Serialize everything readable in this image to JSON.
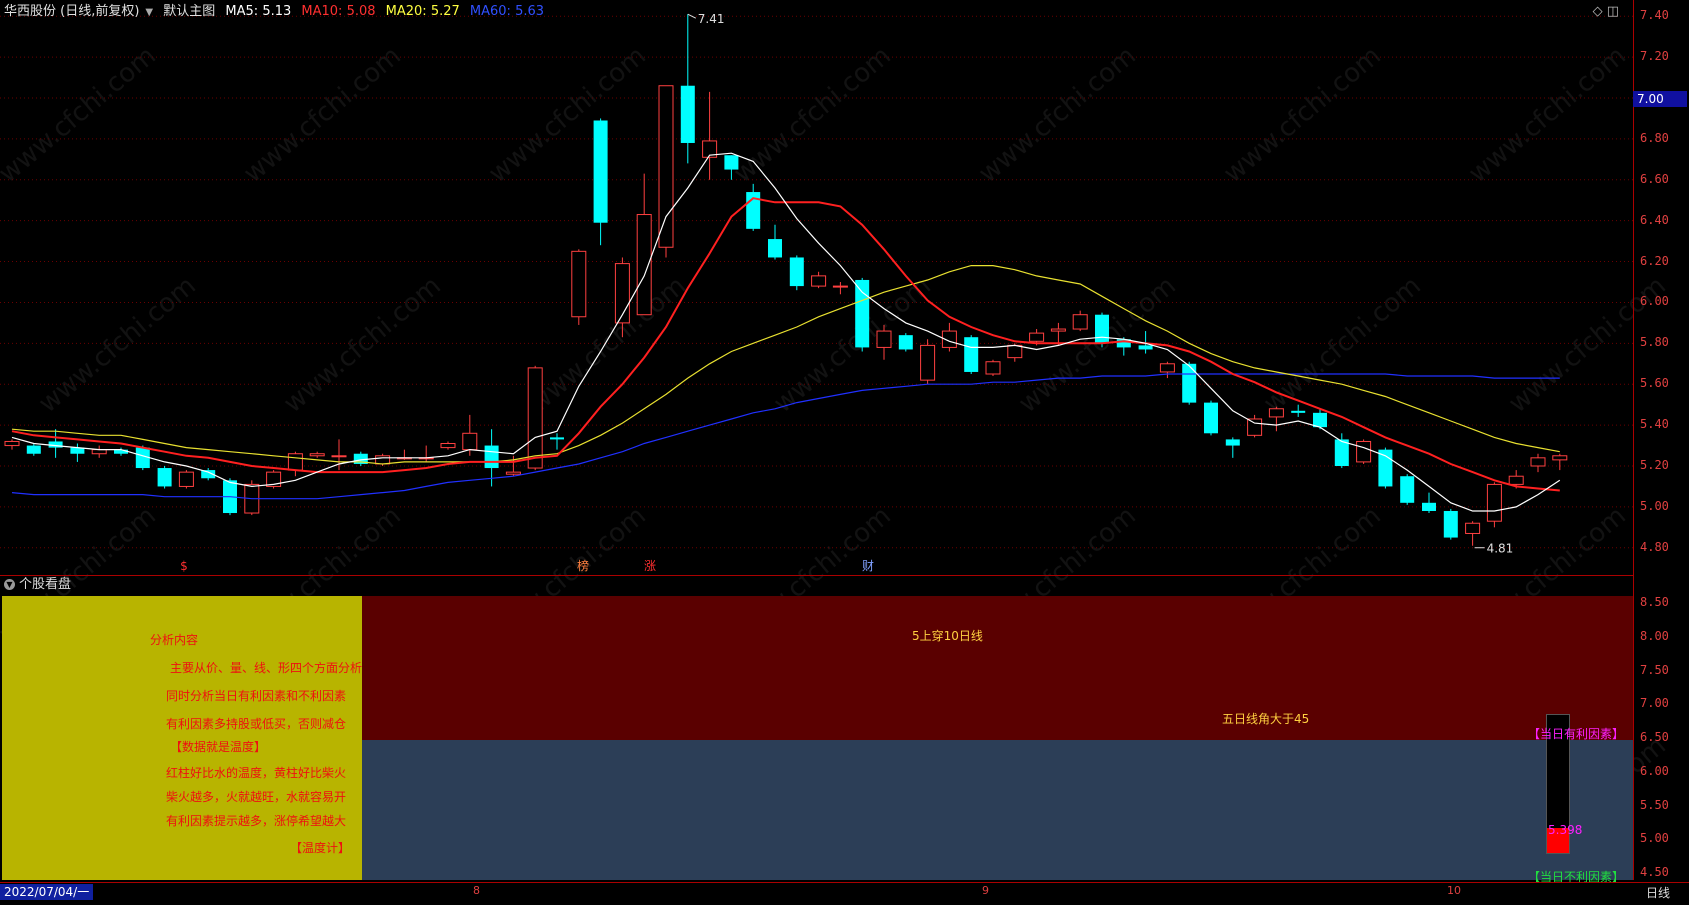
{
  "header": {
    "stock": "华西股份 (日线,前复权)",
    "main_name": "默认主图",
    "ma5": "MA5: 5.13",
    "ma10": "MA10: 5.08",
    "ma20": "MA20: 5.27",
    "ma60": "MA60: 5.63"
  },
  "price_axis": [
    "7.40",
    "7.20",
    "7.00",
    "6.80",
    "6.60",
    "6.40",
    "6.20",
    "6.00",
    "5.80",
    "5.60",
    "5.40",
    "5.20",
    "5.00",
    "4.80"
  ],
  "current_price": "7.00",
  "high_label": "7.41",
  "low_label": "4.81",
  "markers": [
    "$",
    "榜",
    "涨",
    "财"
  ],
  "panel": {
    "title": "个股看盘",
    "axis": [
      "8.50",
      "8.00",
      "7.50",
      "7.00",
      "6.50",
      "6.00",
      "5.50",
      "5.00",
      "4.50"
    ],
    "analysis_title": "分析内容",
    "lines": [
      "主要从价、量、线、形四个方面分析",
      "同时分析当日有利因素和不利因素",
      "有利因素多持股或低买，否则减仓",
      "【数据就是温度】",
      "红柱好比水的温度，黄柱好比柴火",
      "柴火越多，火就越旺，水就容易开",
      "有利因素提示越多，涨停希望越大",
      "【温度计】"
    ],
    "signal1": "5上穿10日线",
    "signal2": "五日线角大于45",
    "favorable": "【当日有利因素】",
    "unfavorable": "【当日不利因素】",
    "temp_value": "5.398",
    "temp_level": 0.18
  },
  "bottom": {
    "date": "2022/07/04/一",
    "ticks": [
      "8",
      "9",
      "10"
    ],
    "period": "日线"
  },
  "watermark": "www.cfchi.com",
  "colors": {
    "up": "#ff4040",
    "down": "#00ffff",
    "ma5": "#ffffff",
    "ma10": "#ff2020",
    "ma20": "#e8e030",
    "ma60": "#2030ff"
  },
  "chart_data": {
    "type": "candlestick",
    "ylim": [
      4.75,
      7.45
    ],
    "candles": [
      [
        5.3,
        5.32,
        5.28,
        5.33
      ],
      [
        5.3,
        5.26,
        5.25,
        5.31
      ],
      [
        5.32,
        5.29,
        5.24,
        5.38
      ],
      [
        5.29,
        5.26,
        5.22,
        5.31
      ],
      [
        5.26,
        5.28,
        5.24,
        5.3
      ],
      [
        5.28,
        5.26,
        5.25,
        5.29
      ],
      [
        5.29,
        5.19,
        5.18,
        5.3
      ],
      [
        5.19,
        5.1,
        5.09,
        5.2
      ],
      [
        5.1,
        5.17,
        5.09,
        5.18
      ],
      [
        5.18,
        5.14,
        5.13,
        5.19
      ],
      [
        5.13,
        4.97,
        4.96,
        5.14
      ],
      [
        4.97,
        5.11,
        4.96,
        5.13
      ],
      [
        5.1,
        5.17,
        5.09,
        5.18
      ],
      [
        5.18,
        5.26,
        5.15,
        5.27
      ],
      [
        5.25,
        5.26,
        5.24,
        5.27
      ],
      [
        5.25,
        5.25,
        5.18,
        5.33
      ],
      [
        5.26,
        5.21,
        5.2,
        5.27
      ],
      [
        5.21,
        5.25,
        5.2,
        5.26
      ],
      [
        5.24,
        5.24,
        5.23,
        5.28
      ],
      [
        5.24,
        5.24,
        5.22,
        5.3
      ],
      [
        5.29,
        5.31,
        5.28,
        5.32
      ],
      [
        5.28,
        5.36,
        5.25,
        5.45
      ],
      [
        5.3,
        5.19,
        5.1,
        5.38
      ],
      [
        5.16,
        5.17,
        5.15,
        5.25
      ],
      [
        5.19,
        5.68,
        5.18,
        5.69
      ],
      [
        5.34,
        5.33,
        5.28,
        5.36
      ],
      [
        5.93,
        6.25,
        5.89,
        6.26
      ],
      [
        6.89,
        6.39,
        6.28,
        6.9
      ],
      [
        5.9,
        6.19,
        5.83,
        6.22
      ],
      [
        5.94,
        6.43,
        5.94,
        6.63
      ],
      [
        6.27,
        7.06,
        6.22,
        7.06
      ],
      [
        7.06,
        6.78,
        6.68,
        7.41
      ],
      [
        6.71,
        6.79,
        6.6,
        7.03
      ],
      [
        6.72,
        6.65,
        6.6,
        6.72
      ],
      [
        6.54,
        6.36,
        6.35,
        6.58
      ],
      [
        6.31,
        6.22,
        6.21,
        6.38
      ],
      [
        6.22,
        6.08,
        6.06,
        6.23
      ],
      [
        6.08,
        6.13,
        6.07,
        6.15
      ],
      [
        6.08,
        6.08,
        6.04,
        6.1
      ],
      [
        6.11,
        5.78,
        5.76,
        6.12
      ],
      [
        5.78,
        5.86,
        5.72,
        5.89
      ],
      [
        5.84,
        5.77,
        5.76,
        5.85
      ],
      [
        5.62,
        5.79,
        5.6,
        5.82
      ],
      [
        5.78,
        5.86,
        5.76,
        5.9
      ],
      [
        5.83,
        5.66,
        5.65,
        5.84
      ],
      [
        5.65,
        5.71,
        5.64,
        5.72
      ],
      [
        5.73,
        5.79,
        5.71,
        5.8
      ],
      [
        5.81,
        5.85,
        5.79,
        5.87
      ],
      [
        5.86,
        5.87,
        5.79,
        5.9
      ],
      [
        5.87,
        5.94,
        5.86,
        5.96
      ],
      [
        5.94,
        5.8,
        5.78,
        5.95
      ],
      [
        5.82,
        5.78,
        5.74,
        5.83
      ],
      [
        5.79,
        5.77,
        5.75,
        5.86
      ],
      [
        5.66,
        5.7,
        5.63,
        5.71
      ],
      [
        5.7,
        5.51,
        5.5,
        5.71
      ],
      [
        5.51,
        5.36,
        5.35,
        5.52
      ],
      [
        5.33,
        5.3,
        5.24,
        5.34
      ],
      [
        5.35,
        5.43,
        5.34,
        5.45
      ],
      [
        5.44,
        5.48,
        5.37,
        5.49
      ],
      [
        5.47,
        5.46,
        5.44,
        5.5
      ],
      [
        5.46,
        5.39,
        5.38,
        5.48
      ],
      [
        5.33,
        5.2,
        5.19,
        5.36
      ],
      [
        5.22,
        5.32,
        5.21,
        5.33
      ],
      [
        5.28,
        5.1,
        5.09,
        5.29
      ],
      [
        5.15,
        5.02,
        5.01,
        5.16
      ],
      [
        5.02,
        4.98,
        4.97,
        5.07
      ],
      [
        4.98,
        4.85,
        4.84,
        4.99
      ],
      [
        4.87,
        4.92,
        4.81,
        4.93
      ],
      [
        4.93,
        5.11,
        4.9,
        5.12
      ],
      [
        5.11,
        5.15,
        5.09,
        5.18
      ],
      [
        5.2,
        5.24,
        5.17,
        5.26
      ],
      [
        5.23,
        5.25,
        5.18,
        5.26
      ]
    ],
    "ma5": [
      5.34,
      5.31,
      5.3,
      5.29,
      5.28,
      5.28,
      5.25,
      5.22,
      5.2,
      5.17,
      5.12,
      5.1,
      5.11,
      5.13,
      5.17,
      5.21,
      5.23,
      5.24,
      5.24,
      5.24,
      5.25,
      5.28,
      5.27,
      5.26,
      5.34,
      5.37,
      5.59,
      5.76,
      5.94,
      6.13,
      6.42,
      6.56,
      6.72,
      6.73,
      6.69,
      6.56,
      6.41,
      6.29,
      6.18,
      6.05,
      5.97,
      5.9,
      5.86,
      5.81,
      5.78,
      5.78,
      5.79,
      5.77,
      5.79,
      5.82,
      5.83,
      5.82,
      5.8,
      5.77,
      5.69,
      5.58,
      5.47,
      5.41,
      5.4,
      5.42,
      5.39,
      5.32,
      5.29,
      5.25,
      5.18,
      5.1,
      5.02,
      4.98,
      4.98,
      5.0,
      5.06,
      5.13
    ],
    "ma10": [
      5.37,
      5.35,
      5.34,
      5.33,
      5.32,
      5.31,
      5.29,
      5.27,
      5.25,
      5.24,
      5.22,
      5.2,
      5.19,
      5.18,
      5.17,
      5.17,
      5.17,
      5.17,
      5.18,
      5.19,
      5.21,
      5.22,
      5.22,
      5.22,
      5.24,
      5.25,
      5.36,
      5.49,
      5.6,
      5.73,
      5.88,
      6.07,
      6.24,
      6.42,
      6.51,
      6.49,
      6.49,
      6.49,
      6.47,
      6.38,
      6.26,
      6.13,
      6.01,
      5.93,
      5.88,
      5.84,
      5.81,
      5.8,
      5.8,
      5.8,
      5.8,
      5.81,
      5.8,
      5.79,
      5.76,
      5.71,
      5.65,
      5.61,
      5.56,
      5.52,
      5.48,
      5.44,
      5.39,
      5.34,
      5.3,
      5.26,
      5.21,
      5.17,
      5.13,
      5.1,
      5.09,
      5.08
    ],
    "ma20": [
      5.38,
      5.37,
      5.37,
      5.36,
      5.35,
      5.35,
      5.33,
      5.31,
      5.29,
      5.28,
      5.27,
      5.26,
      5.25,
      5.24,
      5.23,
      5.22,
      5.22,
      5.21,
      5.22,
      5.22,
      5.22,
      5.22,
      5.22,
      5.23,
      5.25,
      5.26,
      5.3,
      5.35,
      5.41,
      5.48,
      5.55,
      5.63,
      5.7,
      5.76,
      5.8,
      5.84,
      5.88,
      5.93,
      5.97,
      6.01,
      6.05,
      6.08,
      6.11,
      6.15,
      6.18,
      6.18,
      6.16,
      6.13,
      6.11,
      6.09,
      6.03,
      5.97,
      5.91,
      5.86,
      5.8,
      5.75,
      5.71,
      5.68,
      5.66,
      5.64,
      5.62,
      5.6,
      5.57,
      5.54,
      5.5,
      5.46,
      5.42,
      5.38,
      5.34,
      5.31,
      5.29,
      5.27
    ],
    "ma60": [
      5.07,
      5.06,
      5.06,
      5.06,
      5.06,
      5.06,
      5.06,
      5.05,
      5.05,
      5.05,
      5.05,
      5.04,
      5.04,
      5.04,
      5.04,
      5.05,
      5.06,
      5.07,
      5.08,
      5.1,
      5.12,
      5.13,
      5.14,
      5.15,
      5.17,
      5.19,
      5.21,
      5.24,
      5.27,
      5.31,
      5.34,
      5.37,
      5.4,
      5.43,
      5.46,
      5.48,
      5.51,
      5.53,
      5.55,
      5.57,
      5.58,
      5.59,
      5.6,
      5.6,
      5.6,
      5.61,
      5.61,
      5.62,
      5.63,
      5.63,
      5.64,
      5.64,
      5.64,
      5.65,
      5.65,
      5.65,
      5.65,
      5.65,
      5.65,
      5.65,
      5.65,
      5.65,
      5.65,
      5.65,
      5.64,
      5.64,
      5.64,
      5.64,
      5.63,
      5.63,
      5.63,
      5.63
    ]
  }
}
